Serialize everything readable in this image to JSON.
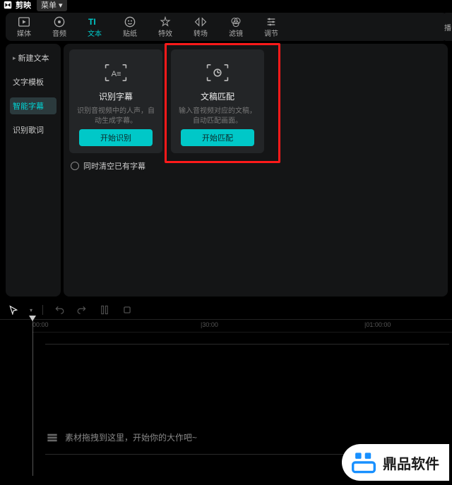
{
  "app": {
    "name": "剪映",
    "menu": "菜单"
  },
  "toolbar": [
    {
      "label": "媒体",
      "icon": "media"
    },
    {
      "label": "音频",
      "icon": "audio"
    },
    {
      "label": "文本",
      "icon": "text",
      "active": true
    },
    {
      "label": "贴纸",
      "icon": "sticker"
    },
    {
      "label": "特效",
      "icon": "effect"
    },
    {
      "label": "转场",
      "icon": "transition"
    },
    {
      "label": "滤镜",
      "icon": "filter"
    },
    {
      "label": "调节",
      "icon": "adjust"
    }
  ],
  "right_sliver": "播",
  "sidebar": {
    "items": [
      {
        "label": "新建文本",
        "caret": true
      },
      {
        "label": "文字模板"
      },
      {
        "label": "智能字幕",
        "active": true
      },
      {
        "label": "识别歌词"
      }
    ]
  },
  "cards": {
    "recognize": {
      "title": "识别字幕",
      "desc": "识别音视频中的人声，自动生成字幕。",
      "button": "开始识别"
    },
    "match": {
      "title": "文稿匹配",
      "desc": "输入音视频对应的文稿，自动匹配画面。",
      "button": "开始匹配"
    }
  },
  "clear_checkbox_label": "同时清空已有字幕",
  "timeline": {
    "ticks": [
      "00:00",
      "|30:00",
      "|01:00:00"
    ],
    "empty_hint": "素材拖拽到这里，开始你的大作吧~"
  },
  "watermark": {
    "text": "鼎品软件"
  }
}
